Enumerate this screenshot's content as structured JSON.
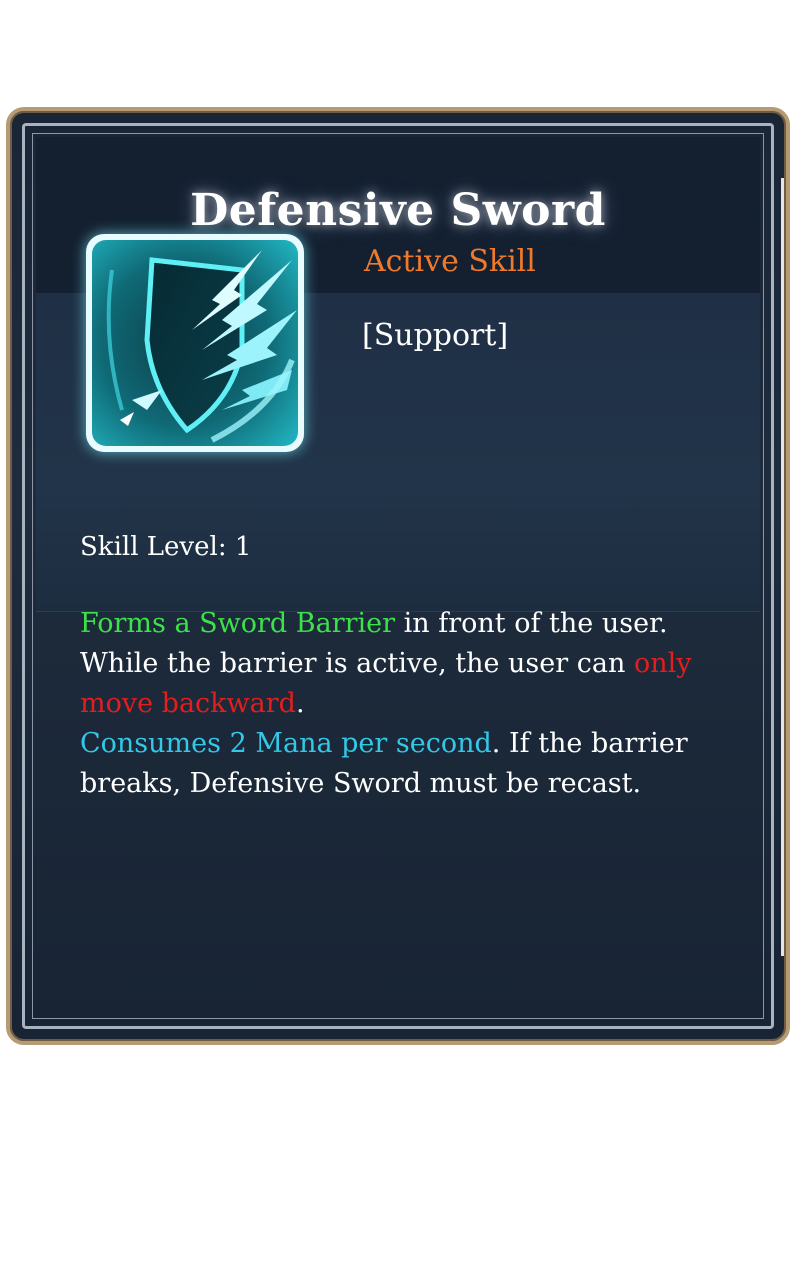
{
  "skill": {
    "title": "Defensive Sword",
    "type": "Active Skill",
    "category": "[Support]",
    "icon": "shield-sword-icon",
    "level_label": "Skill Level: 1",
    "description": {
      "line1_highlight": "Forms a Sword Barrier",
      "line1_rest": " in front of the user.",
      "line2_start": "While the barrier is active, the user can ",
      "line2_highlight": "only move backward",
      "line2_end": ".",
      "line3_highlight": "Consumes 2 Mana per second",
      "line3_rest": ". If the barrier breaks, Defensive Sword must be recast."
    }
  },
  "colors": {
    "type_text": "#f07a2c",
    "highlight_green": "#3ce24a",
    "highlight_red": "#e41d1d",
    "highlight_cyan": "#33c8e6",
    "frame_gold": "#b59a73",
    "panel_bg": "#1a2636"
  }
}
